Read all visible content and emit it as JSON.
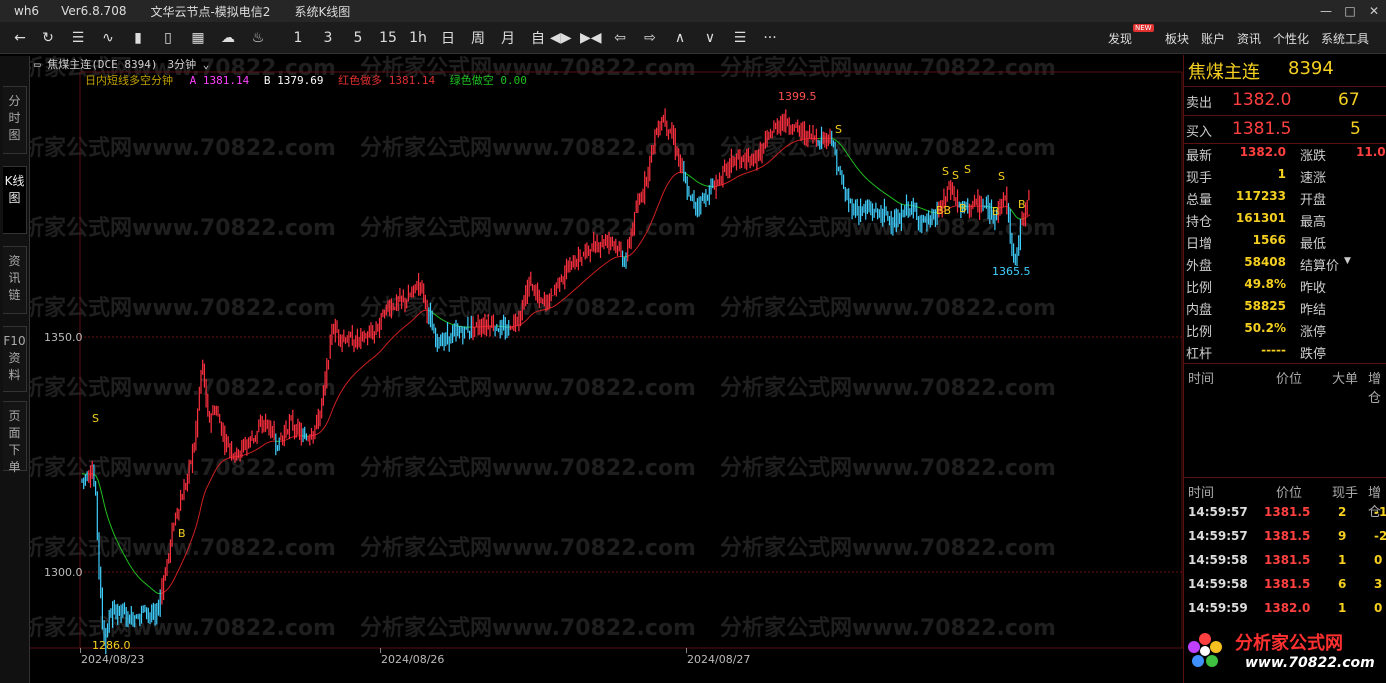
{
  "titlebar": {
    "app": "wh6",
    "version": "Ver6.8.708",
    "node": "文华云节点-模拟电信2",
    "window": "系统K线图",
    "min": "—",
    "max": "□",
    "close": "✕"
  },
  "toolbar": {
    "periods": [
      "1",
      "3",
      "5",
      "15",
      "1h",
      "日",
      "周",
      "月",
      "自"
    ],
    "menu": [
      "发现",
      "板块",
      "账户",
      "资讯",
      "个性化",
      "系统工具"
    ],
    "new_badge": "NEW",
    "more": "···"
  },
  "sidetabs": [
    "分时图",
    "K线图",
    "资讯链",
    "F10资料",
    "页面下单"
  ],
  "chart_header": {
    "instrument": "焦煤主连(DCE 8394)",
    "period": "3分钟",
    "indicator": "日内短线多空分钟",
    "a_label": "A",
    "a_value": "1381.14",
    "b_label": "B",
    "b_value": "1379.69",
    "red_label": "红色做多",
    "red_value": "1381.14",
    "green_label": "绿色做空",
    "green_value": "0.00"
  },
  "chart_data": {
    "type": "candlestick",
    "instrument": "焦煤主连",
    "y_ticks": [
      1300.0,
      1350.0
    ],
    "y_tick_labels": [
      "1300.0",
      "1350.0"
    ],
    "x_labels": [
      "2024/08/23",
      "2024/08/26",
      "2024/08/27"
    ],
    "annotations": [
      {
        "text": "1399.5",
        "kind": "high",
        "price": 1399.5
      },
      {
        "text": "1365.5",
        "kind": "low",
        "price": 1365.5
      },
      {
        "text": "1286.0",
        "kind": "low",
        "price": 1286.0
      }
    ],
    "signals": [
      "S",
      "B",
      "S",
      "S",
      "S",
      "S",
      "BB",
      "B",
      "S",
      "B",
      "B"
    ],
    "colors": {
      "up": "#ff3040",
      "down": "#40d0ff",
      "ma_down": "#20c020",
      "ma_up": "#d02020",
      "annotation": "#ff5050",
      "signal": "#f5d020"
    },
    "watermark": "分析家公式网www.70822.com"
  },
  "quote": {
    "name": "焦煤主连",
    "code": "8394",
    "sell_label": "卖出",
    "sell_price": "1382.0",
    "sell_vol": "67",
    "buy_label": "买入",
    "buy_price": "1381.5",
    "buy_vol": "5",
    "stats_left": [
      {
        "label": "最新",
        "value": "1382.0",
        "color": "#ff4040"
      },
      {
        "label": "现手",
        "value": "1",
        "color": "#f5d020"
      },
      {
        "label": "总量",
        "value": "117233",
        "color": "#f5d020"
      },
      {
        "label": "持仓",
        "value": "161301",
        "color": "#f5d020"
      },
      {
        "label": "日增",
        "value": "1566",
        "color": "#f5d020"
      },
      {
        "label": "外盘",
        "value": "58408",
        "color": "#f5d020"
      },
      {
        "label": "比例",
        "value": "49.8%",
        "color": "#f5d020"
      },
      {
        "label": "内盘",
        "value": "58825",
        "color": "#f5d020"
      },
      {
        "label": "比例",
        "value": "50.2%",
        "color": "#f5d020"
      },
      {
        "label": "杠杆",
        "value": "-----",
        "color": "#f5d020"
      }
    ],
    "stats_right": [
      {
        "label": "涨跌",
        "value": "11.0"
      },
      {
        "label": "速涨",
        "value": ""
      },
      {
        "label": "开盘",
        "value": ""
      },
      {
        "label": "最高",
        "value": ""
      },
      {
        "label": "最低",
        "value": ""
      },
      {
        "label": "结算价",
        "value": ""
      },
      {
        "label": "昨收",
        "value": ""
      },
      {
        "label": "昨结",
        "value": ""
      },
      {
        "label": "涨停",
        "value": ""
      },
      {
        "label": "跌停",
        "value": ""
      }
    ],
    "block1_headers": [
      "时间",
      "价位",
      "大单",
      "增仓"
    ],
    "block2_headers": [
      "时间",
      "价位",
      "现手",
      "增仓"
    ],
    "ticks": [
      {
        "time": "14:59:57",
        "price": "1381.5",
        "vol": "2",
        "chg": "-1"
      },
      {
        "time": "14:59:57",
        "price": "1381.5",
        "vol": "9",
        "chg": "-2"
      },
      {
        "time": "14:59:58",
        "price": "1381.5",
        "vol": "1",
        "chg": "0"
      },
      {
        "time": "14:59:58",
        "price": "1381.5",
        "vol": "6",
        "chg": "3"
      },
      {
        "time": "14:59:59",
        "price": "1382.0",
        "vol": "1",
        "chg": "0"
      }
    ]
  },
  "logo": {
    "line1": "分析家公式网",
    "line2": "www.70822.com"
  }
}
